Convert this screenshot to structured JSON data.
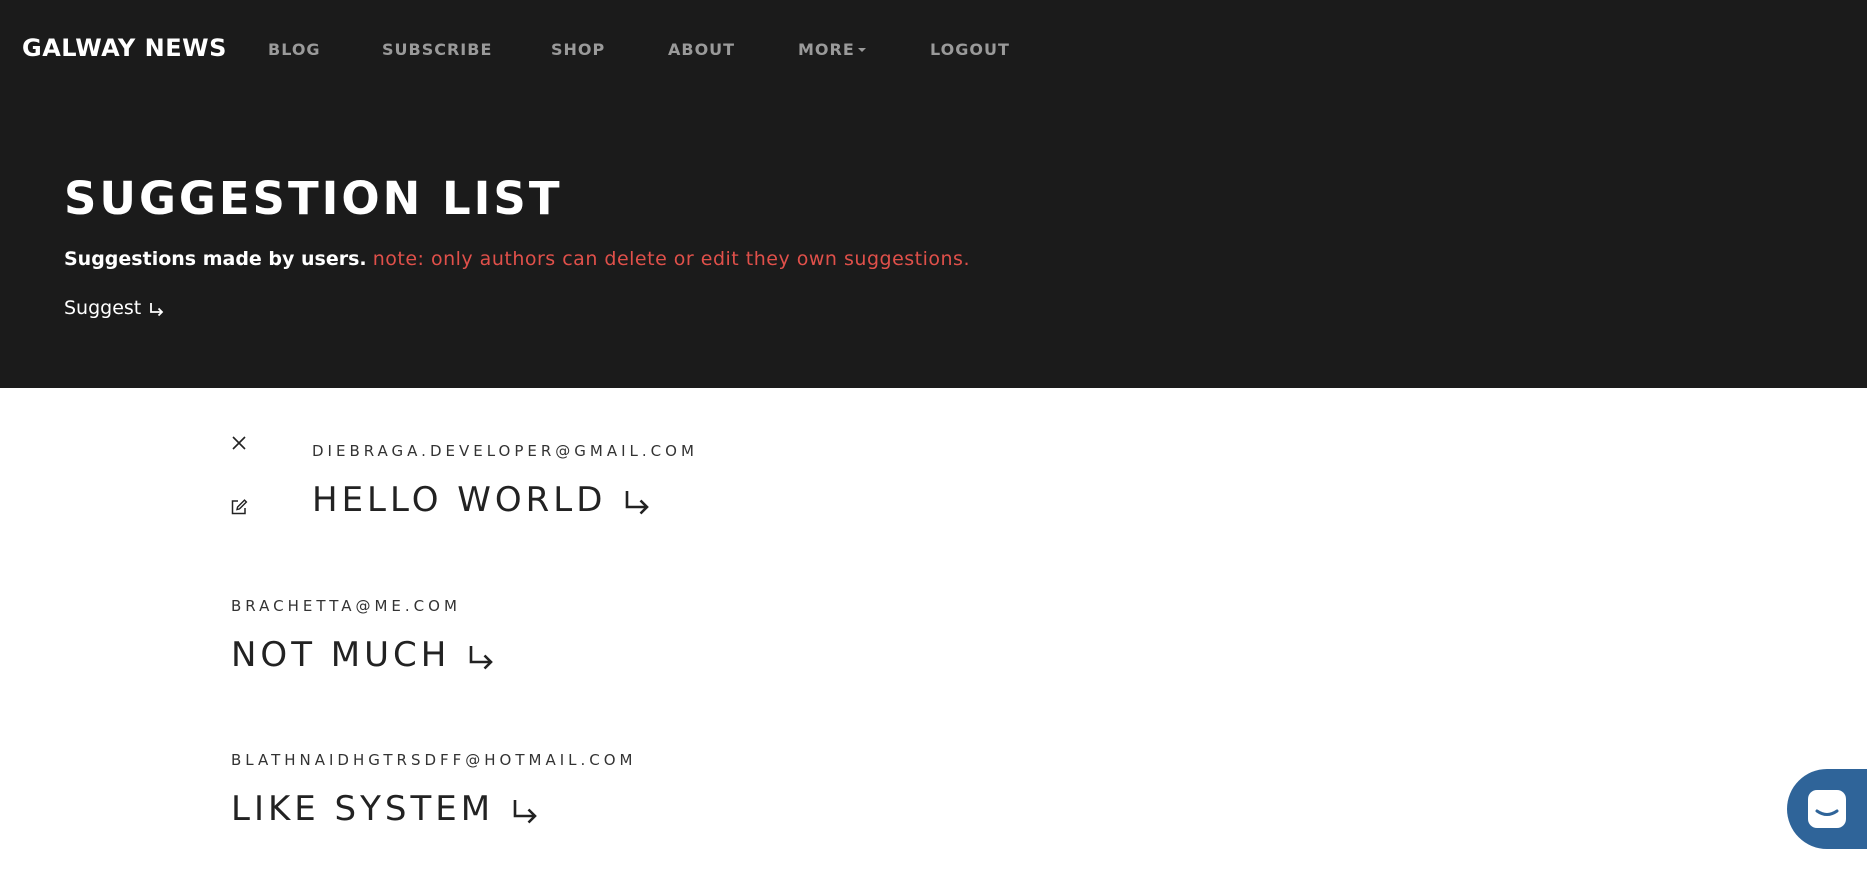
{
  "nav": {
    "brand": "GALWAY NEWS",
    "links": [
      "BLOG",
      "SUBSCRIBE",
      "SHOP",
      "ABOUT",
      "MORE",
      "LOGOUT"
    ]
  },
  "hero": {
    "title": "SUGGESTION LIST",
    "subtitle_lead": "Suggestions made by users.",
    "subtitle_note": "note: only authors can delete or edit they own suggestions.",
    "suggest_label": "Suggest",
    "colors": {
      "background": "#1b1b1b",
      "note": "#e0504a"
    }
  },
  "suggestions": [
    {
      "author": "DIEBRAGA.DEVELOPER@GMAIL.COM",
      "title": "HELLO WORLD",
      "can_edit": true
    },
    {
      "author": "BRACHETTA@ME.COM",
      "title": "NOT MUCH",
      "can_edit": false
    },
    {
      "author": "BLATHNAIDHGTRSDFF@HOTMAIL.COM",
      "title": "LIKE SYSTEM",
      "can_edit": false
    }
  ],
  "icons": {
    "delete": "close-icon",
    "edit": "edit-icon",
    "arrow": "arrow-down-right-icon",
    "chat": "chat-icon"
  },
  "chat": {
    "color": "#2f6499"
  }
}
